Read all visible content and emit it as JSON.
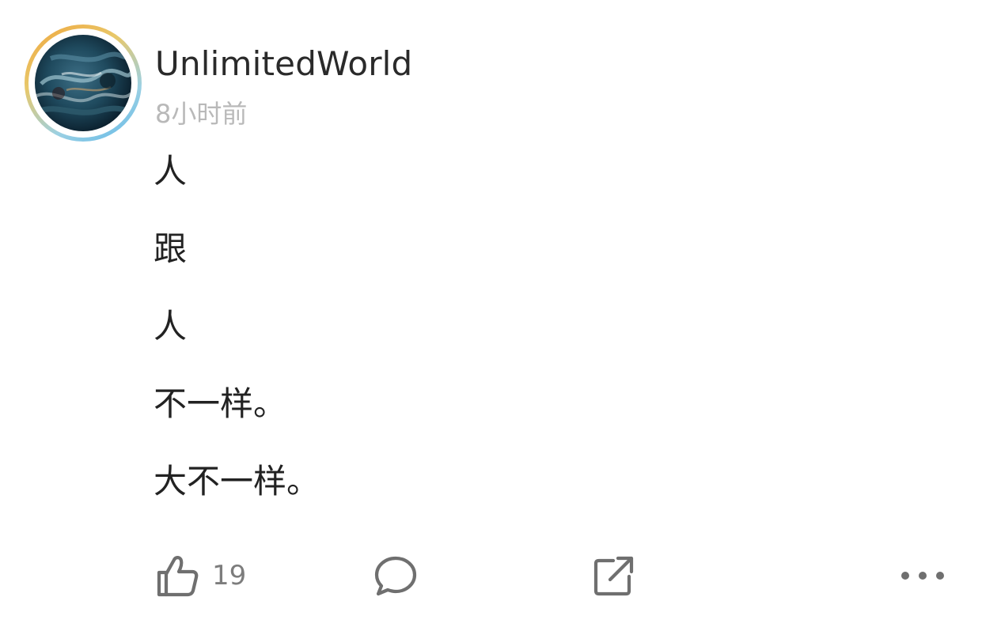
{
  "post": {
    "author": {
      "username": "UnlimitedWorld",
      "avatar_icon": "abstract-painting-avatar"
    },
    "timestamp": "8小时前",
    "lines": [
      "人",
      "跟",
      "人",
      "不一样。",
      "大不一样。"
    ],
    "actions": {
      "like": {
        "icon": "thumbs-up-icon",
        "count": "19"
      },
      "comment": {
        "icon": "comment-bubble-icon"
      },
      "share": {
        "icon": "share-arrow-icon"
      },
      "more": {
        "icon": "more-dots-icon"
      }
    },
    "colors": {
      "ring_start": "#f0a53c",
      "ring_end": "#5fb8e8",
      "muted_text": "#b9b9b9",
      "icon_gray": "#6f6f6f"
    }
  }
}
